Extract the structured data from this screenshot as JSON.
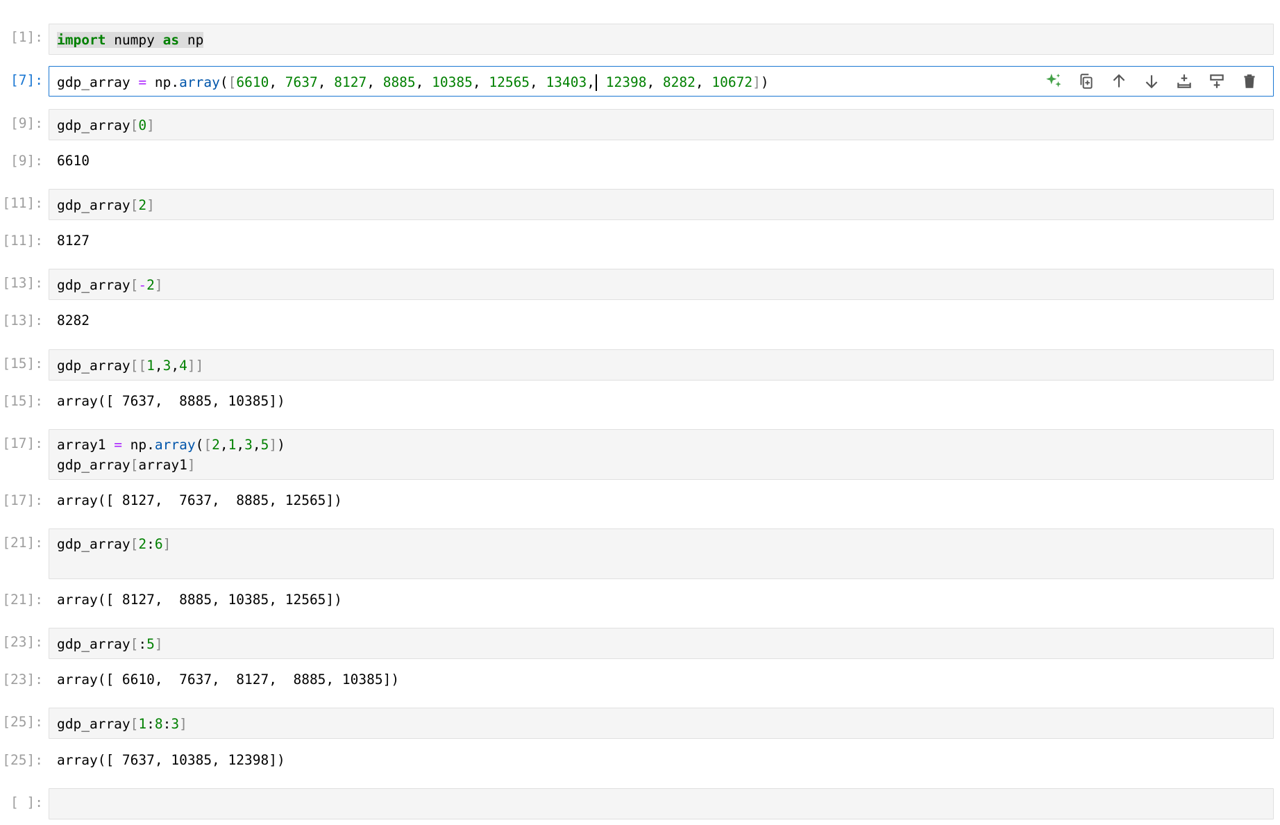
{
  "cells": [
    {
      "prompt": "[1]:",
      "lines": [
        [
          {
            "t": "import",
            "c": "kw sel"
          },
          {
            "t": " numpy ",
            "c": "sel"
          },
          {
            "t": "as",
            "c": "kw sel"
          },
          {
            "t": " np",
            "c": "sel"
          }
        ]
      ]
    },
    {
      "prompt": "[7]:",
      "active": true,
      "lines": [
        [
          {
            "t": "gdp_array "
          },
          {
            "t": "=",
            "c": "op"
          },
          {
            "t": " np"
          },
          {
            "t": "."
          },
          {
            "t": "array",
            "c": "fn"
          },
          {
            "t": "("
          },
          {
            "t": "[",
            "c": "br"
          },
          {
            "t": "6610",
            "c": "num"
          },
          {
            "t": ", "
          },
          {
            "t": "7637",
            "c": "num"
          },
          {
            "t": ", "
          },
          {
            "t": "8127",
            "c": "num"
          },
          {
            "t": ", "
          },
          {
            "t": "8885",
            "c": "num"
          },
          {
            "t": ", "
          },
          {
            "t": "10385",
            "c": "num"
          },
          {
            "t": ", "
          },
          {
            "t": "12565",
            "c": "num"
          },
          {
            "t": ", "
          },
          {
            "t": "13403",
            "c": "num"
          },
          {
            "t": ",",
            "cursor_after": true
          },
          {
            "t": " "
          },
          {
            "t": "12398",
            "c": "num"
          },
          {
            "t": ", "
          },
          {
            "t": "8282",
            "c": "num"
          },
          {
            "t": ", "
          },
          {
            "t": "10672",
            "c": "num"
          },
          {
            "t": "]",
            "c": "br"
          },
          {
            "t": ")"
          }
        ]
      ]
    },
    {
      "prompt": "[9]:",
      "lines": [
        [
          {
            "t": "gdp_array"
          },
          {
            "t": "[",
            "c": "br"
          },
          {
            "t": "0",
            "c": "num"
          },
          {
            "t": "]",
            "c": "br"
          }
        ]
      ],
      "out_prompt": "[9]:",
      "output": "6610"
    },
    {
      "prompt": "[11]:",
      "lines": [
        [
          {
            "t": "gdp_array"
          },
          {
            "t": "[",
            "c": "br"
          },
          {
            "t": "2",
            "c": "num"
          },
          {
            "t": "]",
            "c": "br"
          }
        ]
      ],
      "out_prompt": "[11]:",
      "output": "8127"
    },
    {
      "prompt": "[13]:",
      "lines": [
        [
          {
            "t": "gdp_array"
          },
          {
            "t": "[",
            "c": "br"
          },
          {
            "t": "-",
            "c": "op"
          },
          {
            "t": "2",
            "c": "num"
          },
          {
            "t": "]",
            "c": "br"
          }
        ]
      ],
      "out_prompt": "[13]:",
      "output": "8282"
    },
    {
      "prompt": "[15]:",
      "lines": [
        [
          {
            "t": "gdp_array"
          },
          {
            "t": "[[",
            "c": "br"
          },
          {
            "t": "1",
            "c": "num"
          },
          {
            "t": ","
          },
          {
            "t": "3",
            "c": "num"
          },
          {
            "t": ","
          },
          {
            "t": "4",
            "c": "num"
          },
          {
            "t": "]]",
            "c": "br"
          }
        ]
      ],
      "out_prompt": "[15]:",
      "output": "array([ 7637,  8885, 10385])"
    },
    {
      "prompt": "[17]:",
      "lines": [
        [
          {
            "t": "array1 "
          },
          {
            "t": "=",
            "c": "op"
          },
          {
            "t": " np"
          },
          {
            "t": "."
          },
          {
            "t": "array",
            "c": "fn"
          },
          {
            "t": "("
          },
          {
            "t": "[",
            "c": "br"
          },
          {
            "t": "2",
            "c": "num"
          },
          {
            "t": ","
          },
          {
            "t": "1",
            "c": "num"
          },
          {
            "t": ","
          },
          {
            "t": "3",
            "c": "num"
          },
          {
            "t": ","
          },
          {
            "t": "5",
            "c": "num"
          },
          {
            "t": "]",
            "c": "br"
          },
          {
            "t": ")"
          }
        ],
        [
          {
            "t": "gdp_array"
          },
          {
            "t": "[",
            "c": "br"
          },
          {
            "t": "array1"
          },
          {
            "t": "]",
            "c": "br"
          }
        ]
      ],
      "out_prompt": "[17]:",
      "output": "array([ 8127,  7637,  8885, 12565])"
    },
    {
      "prompt": "[21]:",
      "lines": [
        [
          {
            "t": "gdp_array"
          },
          {
            "t": "[",
            "c": "br"
          },
          {
            "t": "2",
            "c": "num"
          },
          {
            "t": ":"
          },
          {
            "t": "6",
            "c": "num"
          },
          {
            "t": "]",
            "c": "br"
          }
        ],
        []
      ],
      "out_prompt": "[21]:",
      "output": "array([ 8127,  8885, 10385, 12565])"
    },
    {
      "prompt": "[23]:",
      "lines": [
        [
          {
            "t": "gdp_array"
          },
          {
            "t": "[",
            "c": "br"
          },
          {
            "t": ":"
          },
          {
            "t": "5",
            "c": "num"
          },
          {
            "t": "]",
            "c": "br"
          }
        ]
      ],
      "out_prompt": "[23]:",
      "output": "array([ 6610,  7637,  8127,  8885, 10385])"
    },
    {
      "prompt": "[25]:",
      "lines": [
        [
          {
            "t": "gdp_array"
          },
          {
            "t": "[",
            "c": "br"
          },
          {
            "t": "1",
            "c": "num"
          },
          {
            "t": ":"
          },
          {
            "t": "8",
            "c": "num"
          },
          {
            "t": ":"
          },
          {
            "t": "3",
            "c": "num"
          },
          {
            "t": "]",
            "c": "br"
          }
        ]
      ],
      "out_prompt": "[25]:",
      "output": "array([ 7637, 10385, 12398])"
    },
    {
      "prompt": "[ ]:",
      "lines": [
        []
      ]
    }
  ],
  "toolbar": [
    {
      "icon": "sparkle-assistant-icon"
    },
    {
      "icon": "duplicate-cell-icon"
    },
    {
      "icon": "move-up-icon"
    },
    {
      "icon": "move-down-icon"
    },
    {
      "icon": "insert-below-icon"
    },
    {
      "icon": "insert-above-icon"
    },
    {
      "icon": "delete-cell-icon"
    }
  ],
  "colors": {
    "accent": "#1976d2",
    "keyword": "#008000",
    "number": "#008000",
    "operator": "#aa22ff",
    "function": "#0055aa",
    "sparkle": "#43a047"
  }
}
